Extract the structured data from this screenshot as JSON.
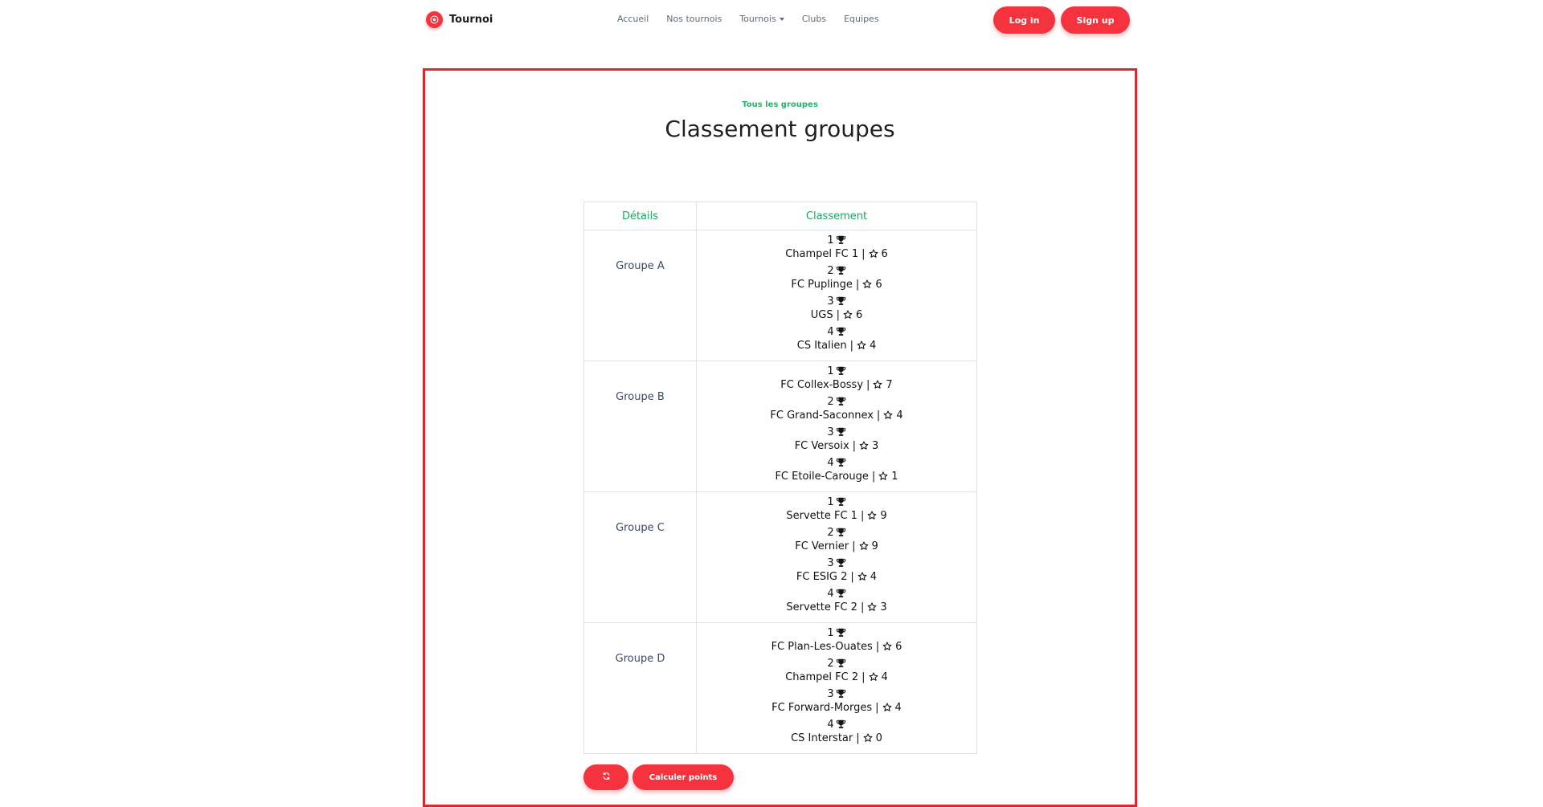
{
  "colors": {
    "accent": "#f5333f",
    "frame": "#e3242b",
    "green": "#27b26b",
    "group_text": "#3b4a6b"
  },
  "navbar": {
    "brand": "Tournoi",
    "links": [
      {
        "label": "Accueil"
      },
      {
        "label": "Nos tournois"
      },
      {
        "label": "Tournois",
        "has_dropdown": true
      },
      {
        "label": "Clubs"
      },
      {
        "label": "Equipes"
      }
    ],
    "login_label": "Log in",
    "signup_label": "Sign up"
  },
  "main": {
    "eyebrow": "Tous les groupes",
    "title": "Classement groupes",
    "table": {
      "headers": {
        "details": "Détails",
        "standings": "Classement"
      },
      "groups": [
        {
          "name": "Groupe A",
          "entries": [
            {
              "rank": "1",
              "team": "Champel FC 1",
              "points": "6"
            },
            {
              "rank": "2",
              "team": "FC Puplinge",
              "points": "6"
            },
            {
              "rank": "3",
              "team": "UGS",
              "points": "6"
            },
            {
              "rank": "4",
              "team": "CS Italien",
              "points": "4"
            }
          ]
        },
        {
          "name": "Groupe B",
          "entries": [
            {
              "rank": "1",
              "team": "FC Collex-Bossy",
              "points": "7"
            },
            {
              "rank": "2",
              "team": "FC Grand-Saconnex",
              "points": "4"
            },
            {
              "rank": "3",
              "team": "FC Versoix",
              "points": "3"
            },
            {
              "rank": "4",
              "team": "FC Etoile-Carouge",
              "points": "1"
            }
          ]
        },
        {
          "name": "Groupe C",
          "entries": [
            {
              "rank": "1",
              "team": "Servette FC 1",
              "points": "9"
            },
            {
              "rank": "2",
              "team": "FC Vernier",
              "points": "9"
            },
            {
              "rank": "3",
              "team": "FC ESIG 2",
              "points": "4"
            },
            {
              "rank": "4",
              "team": "Servette FC 2",
              "points": "3"
            }
          ]
        },
        {
          "name": "Groupe D",
          "entries": [
            {
              "rank": "1",
              "team": "FC Plan-Les-Ouates",
              "points": "6"
            },
            {
              "rank": "2",
              "team": "Champel FC 2",
              "points": "4"
            },
            {
              "rank": "3",
              "team": "FC Forward-Morges",
              "points": "4"
            },
            {
              "rank": "4",
              "team": "CS Interstar",
              "points": "0"
            }
          ]
        }
      ]
    },
    "actions": {
      "refresh_icon": "refresh-icon",
      "calculate_label": "Calculer points"
    }
  }
}
